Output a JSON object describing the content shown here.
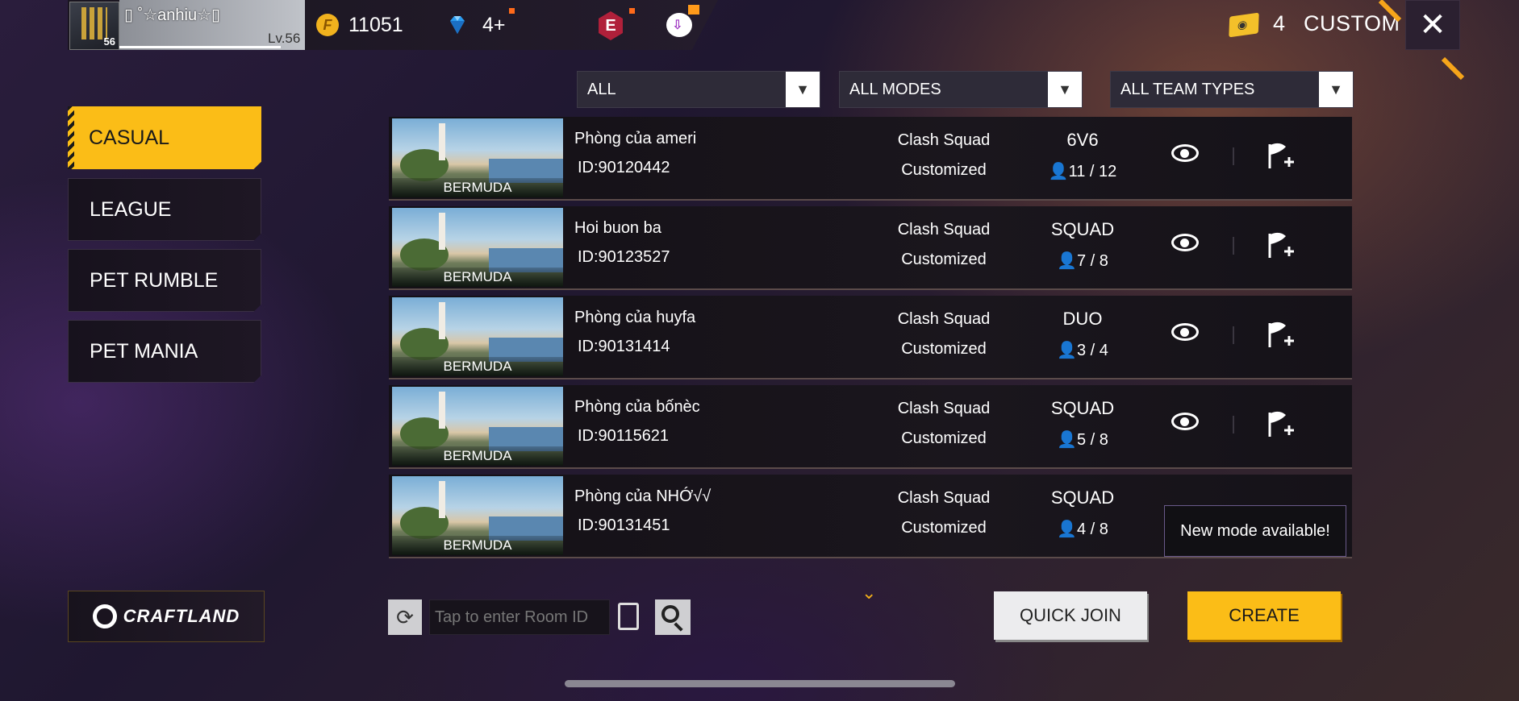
{
  "header": {
    "player_name": "▯ ˚☆anhiu☆▯",
    "level_label": "Lv.56",
    "avatar_level": "56",
    "coin_icon_letter": "F",
    "coins": "11051",
    "diamonds": "4+",
    "event_badge": "E",
    "ticket_count": "4",
    "mode_title": "CUSTOM",
    "close_icon": "✕"
  },
  "filters": {
    "region": "ALL",
    "modes": "ALL MODES",
    "team_types": "ALL TEAM TYPES"
  },
  "sidebar": {
    "tabs": [
      {
        "label": "CASUAL",
        "active": true
      },
      {
        "label": "LEAGUE",
        "active": false
      },
      {
        "label": "PET RUMBLE",
        "active": false
      },
      {
        "label": "PET MANIA",
        "active": false
      }
    ]
  },
  "rooms": [
    {
      "map": "BERMUDA",
      "name": "Phòng của ameri",
      "id": "ID:90120442",
      "mode": "Clash Squad",
      "type": "Customized",
      "team": "6V6",
      "players": "11 / 12"
    },
    {
      "map": "BERMUDA",
      "name": "Hoi buon ba",
      "id": "ID:90123527",
      "mode": "Clash Squad",
      "type": "Customized",
      "team": "SQUAD",
      "players": "7 / 8"
    },
    {
      "map": "BERMUDA",
      "name": "Phòng của huyfa",
      "id": "ID:90131414",
      "mode": "Clash Squad",
      "type": "Customized",
      "team": "DUO",
      "players": "3 / 4"
    },
    {
      "map": "BERMUDA",
      "name": "Phòng của bốnèc",
      "id": "ID:90115621",
      "mode": "Clash Squad",
      "type": "Customized",
      "team": "SQUAD",
      "players": "5 / 8"
    },
    {
      "map": "BERMUDA",
      "name": "Phòng của NHỚ√√",
      "id": "ID:90131451",
      "mode": "Clash Squad",
      "type": "Customized",
      "team": "SQUAD",
      "players": "4 / 8"
    }
  ],
  "tooltip": "New mode available!",
  "bottom": {
    "craftland": "CRAFTLAND",
    "room_input_placeholder": "Tap to enter Room ID",
    "quick_join": "QUICK JOIN",
    "create": "CREATE"
  },
  "icons": {
    "refresh": "refresh-icon",
    "clipboard": "clipboard-icon",
    "search": "search-icon",
    "eye": "eye-icon",
    "flag": "flag-plus-icon",
    "chevron": "chevron-down-icon"
  },
  "colors": {
    "accent": "#fbbd17",
    "panel": "#141016",
    "coin": "#f1b21e",
    "diamond": "#2a9bf0"
  }
}
